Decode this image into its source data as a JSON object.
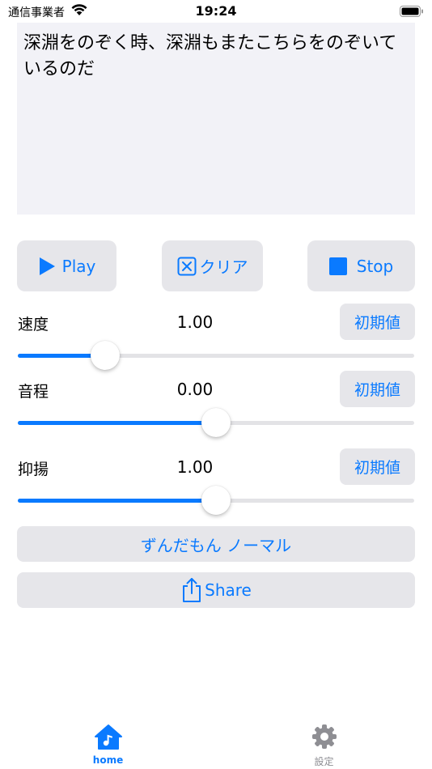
{
  "status_bar": {
    "carrier": "通信事業者",
    "time": "19:24"
  },
  "text_area": {
    "value": "深淵をのぞく時、深淵もまたこちらをのぞいているのだ"
  },
  "controls": {
    "play_label": "Play",
    "clear_label": "クリア",
    "stop_label": "Stop"
  },
  "sliders": [
    {
      "label": "速度",
      "value_text": "1.00",
      "reset_label": "初期値",
      "fraction": 0.22
    },
    {
      "label": "音程",
      "value_text": "0.00",
      "reset_label": "初期値",
      "fraction": 0.5
    },
    {
      "label": "抑揚",
      "value_text": "1.00",
      "reset_label": "初期値",
      "fraction": 0.5
    }
  ],
  "voice_button": {
    "label": "ずんだもん ノーマル"
  },
  "share_button": {
    "label": "Share"
  },
  "tab_bar": {
    "items": [
      {
        "label": "home",
        "icon": "house-icon",
        "selected": true
      },
      {
        "label": "設定",
        "icon": "gear-icon",
        "selected": false
      }
    ]
  },
  "colors": {
    "accent": "#0a7aff",
    "button_bg": "#e6e6ea",
    "text_area_bg": "#f2f2f7",
    "inactive_tab": "#8e8e93"
  }
}
